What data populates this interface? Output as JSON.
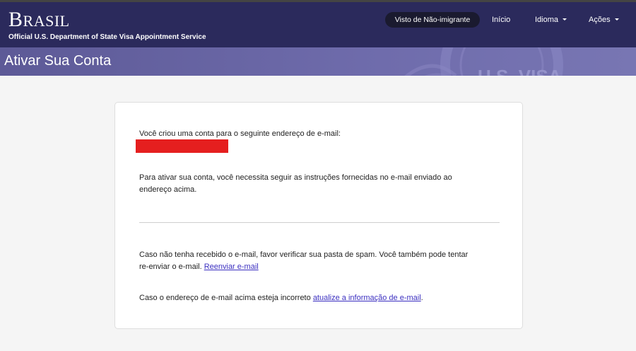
{
  "header": {
    "brand_big": "B",
    "brand_rest": "RASIL",
    "subtitle": "Official U.S. Department of State Visa Appointment Service",
    "nav_pill": "Visto de Não-imigrante",
    "nav_inicio": "Início",
    "nav_idioma": "Idioma",
    "nav_acoes": "Ações"
  },
  "banner": {
    "title": "Ativar Sua Conta",
    "seal_text": "U.S. VISA"
  },
  "card": {
    "line1": "Você criou uma conta para o seguinte endereço de e-mail:",
    "line2a": "Para ativar sua conta, você necessita seguir as instruções fornecidas no e-mail enviado ao",
    "line2b": "endereço acima.",
    "line3a": "Caso não tenha recebido o e-mail, favor verificar sua pasta de spam. Você também pode tentar",
    "line3b": "re-enviar o e-mail.",
    "resend_link": "Reenviar e-mail",
    "line4": "Caso o endereço de e-mail acima esteja incorreto",
    "update_link": "atualize a informação de e-mail",
    "line4_end": "."
  },
  "colors": {
    "header_bg": "#2b2a5c",
    "banner_bg": "#6f6cac",
    "redaction": "#e51f1f",
    "link": "#3b2fc0"
  }
}
